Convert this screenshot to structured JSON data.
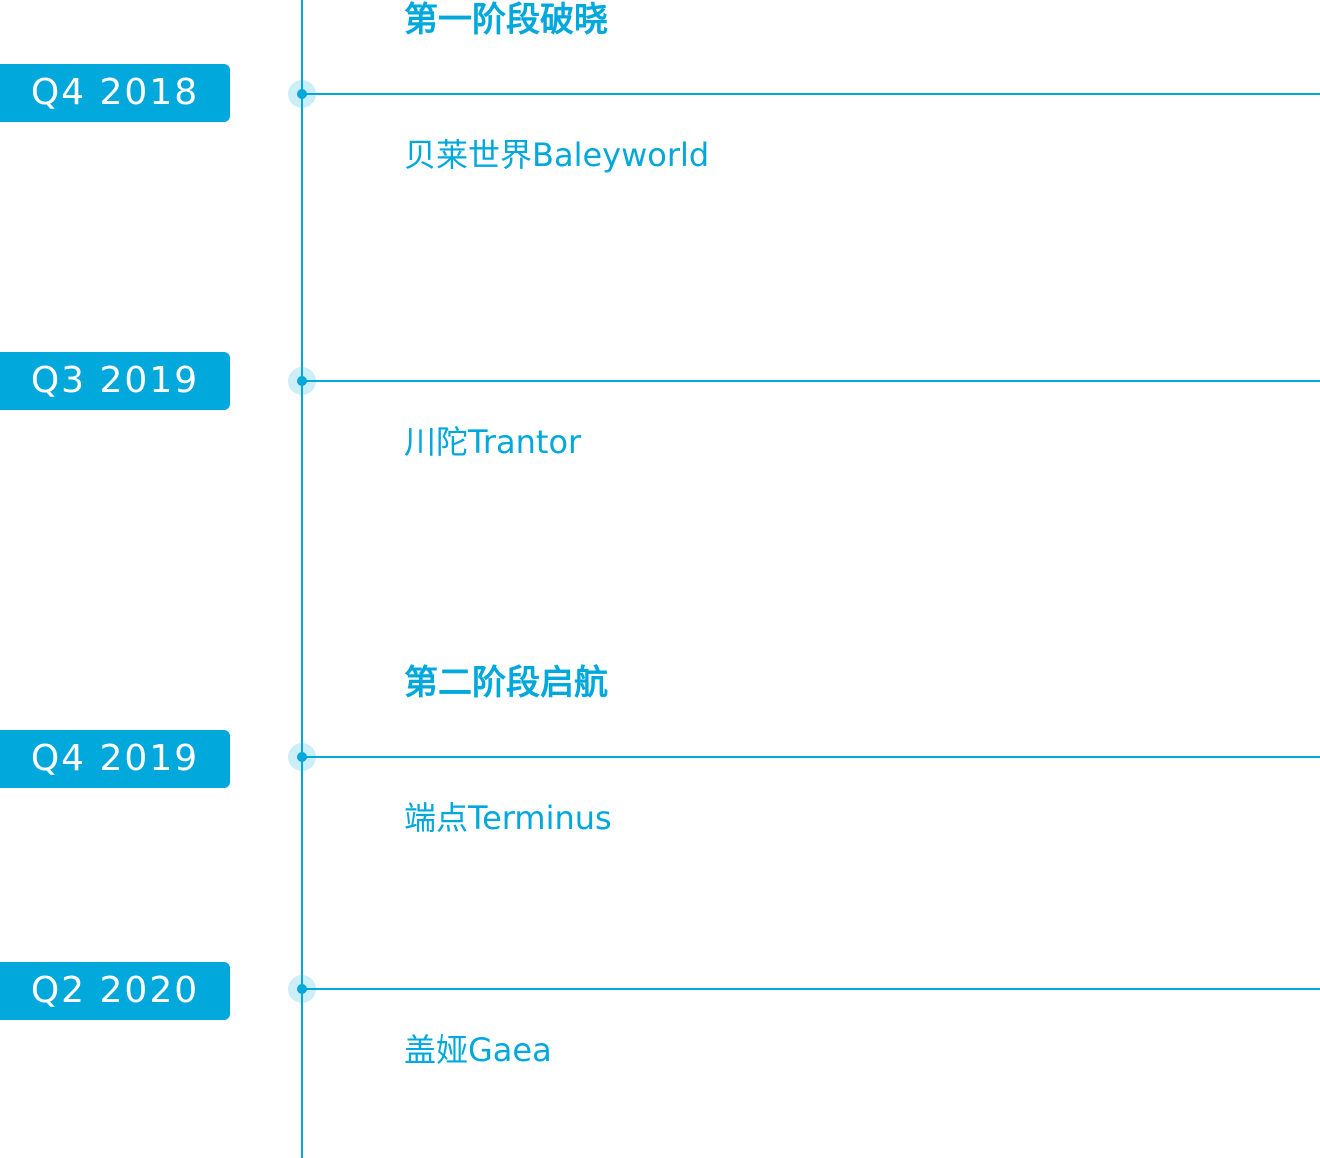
{
  "phases": [
    {
      "title": "第一阶段破晓"
    },
    {
      "title": "第二阶段启航"
    }
  ],
  "milestones": [
    {
      "quarter": "Q4 2018",
      "project": "贝莱世界Baleyworld"
    },
    {
      "quarter": "Q3 2019",
      "project": "川陀Trantor"
    },
    {
      "quarter": "Q4 2019",
      "project": "端点Terminus"
    },
    {
      "quarter": "Q2 2020",
      "project": "盖娅Gaea"
    }
  ],
  "colors": {
    "accent": "#00a8dc",
    "badge_text": "#ffffff",
    "background": "#ffffff"
  }
}
